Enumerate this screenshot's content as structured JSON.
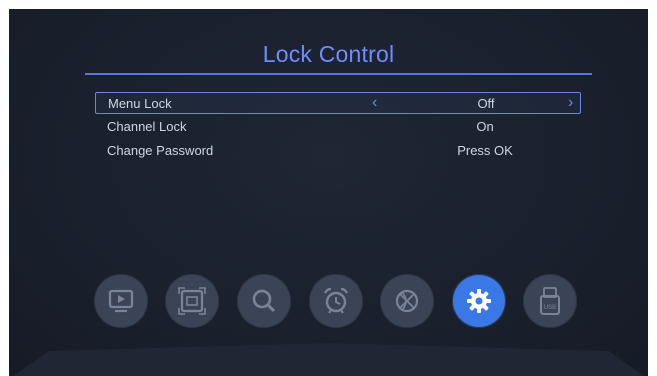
{
  "title": "Lock Control",
  "menu": [
    {
      "label": "Menu Lock",
      "value": "Off",
      "selected": true
    },
    {
      "label": "Channel Lock",
      "value": "On",
      "selected": false
    },
    {
      "label": "Change Password",
      "value": "Press OK",
      "selected": false
    }
  ],
  "arrows": {
    "left": "‹",
    "right": "›"
  },
  "dock": [
    {
      "icon": "tv-play-icon",
      "active": false
    },
    {
      "icon": "picture-icon",
      "active": false
    },
    {
      "icon": "search-icon",
      "active": false
    },
    {
      "icon": "alarm-clock-icon",
      "active": false
    },
    {
      "icon": "ball-icon",
      "active": false
    },
    {
      "icon": "gear-icon",
      "active": true
    },
    {
      "icon": "usb-icon",
      "active": false,
      "label": "USB"
    }
  ],
  "colors": {
    "accent": "#6f8cff",
    "active_dock": "#3a78e6"
  }
}
